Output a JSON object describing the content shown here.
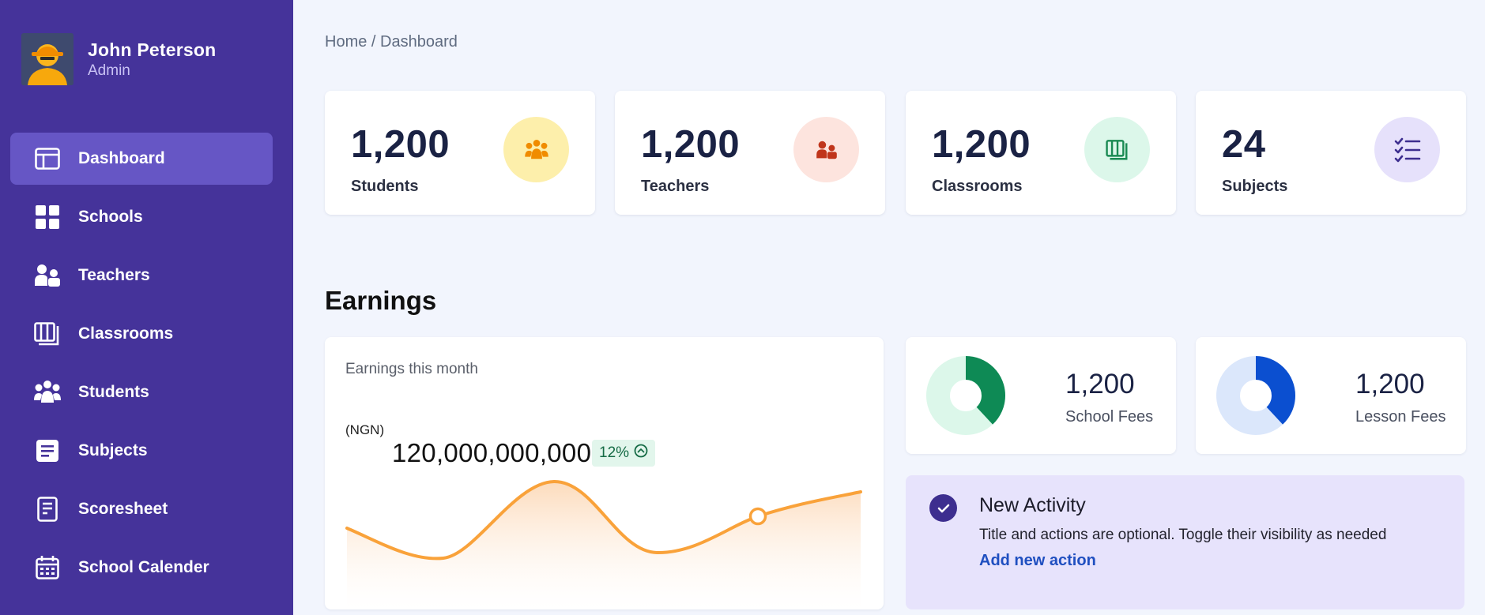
{
  "user": {
    "name": "John Peterson",
    "role": "Admin"
  },
  "sidebar": {
    "items": [
      {
        "label": "Dashboard",
        "icon": "dashboard-icon",
        "active": true
      },
      {
        "label": "Schools",
        "icon": "grid-icon"
      },
      {
        "label": "Teachers",
        "icon": "teachers-icon"
      },
      {
        "label": "Classrooms",
        "icon": "classrooms-icon"
      },
      {
        "label": "Students",
        "icon": "students-icon"
      },
      {
        "label": "Subjects",
        "icon": "subjects-icon"
      },
      {
        "label": "Scoresheet",
        "icon": "scoresheet-icon"
      },
      {
        "label": "School Calender",
        "icon": "calendar-icon"
      }
    ]
  },
  "breadcrumb": "Home / Dashboard",
  "stats": [
    {
      "value": "1,200",
      "label": "Students",
      "icon": "students-group-icon",
      "bg": "#fdefab",
      "fg": "#f08c00"
    },
    {
      "value": "1,200",
      "label": "Teachers",
      "icon": "teachers-icon",
      "bg": "#fde4de",
      "fg": "#c0351b"
    },
    {
      "value": "1,200",
      "label": "Classrooms",
      "icon": "classrooms-icon",
      "bg": "#dcf7ea",
      "fg": "#1a8a53"
    },
    {
      "value": "24",
      "label": "Subjects",
      "icon": "checklist-icon",
      "bg": "#e6e1fb",
      "fg": "#3d2e8f"
    }
  ],
  "earnings": {
    "section_title": "Earnings",
    "card_title": "Earnings this month",
    "currency": "(NGN)",
    "amount": "120,000,000,000",
    "change": "12%",
    "line_color": "#f9a23a"
  },
  "fees": [
    {
      "value": "1,200",
      "label": "School Fees",
      "color": "#0e8a55",
      "track": "#dcf7ea",
      "fraction": 0.38
    },
    {
      "value": "1,200",
      "label": "Lesson Fees",
      "color": "#0b4fd0",
      "track": "#dbe7fb",
      "fraction": 0.38
    }
  ],
  "activity": {
    "title": "New Activity",
    "description": "Title and actions are optional. Toggle their visibility as needed",
    "link": "Add new action"
  }
}
